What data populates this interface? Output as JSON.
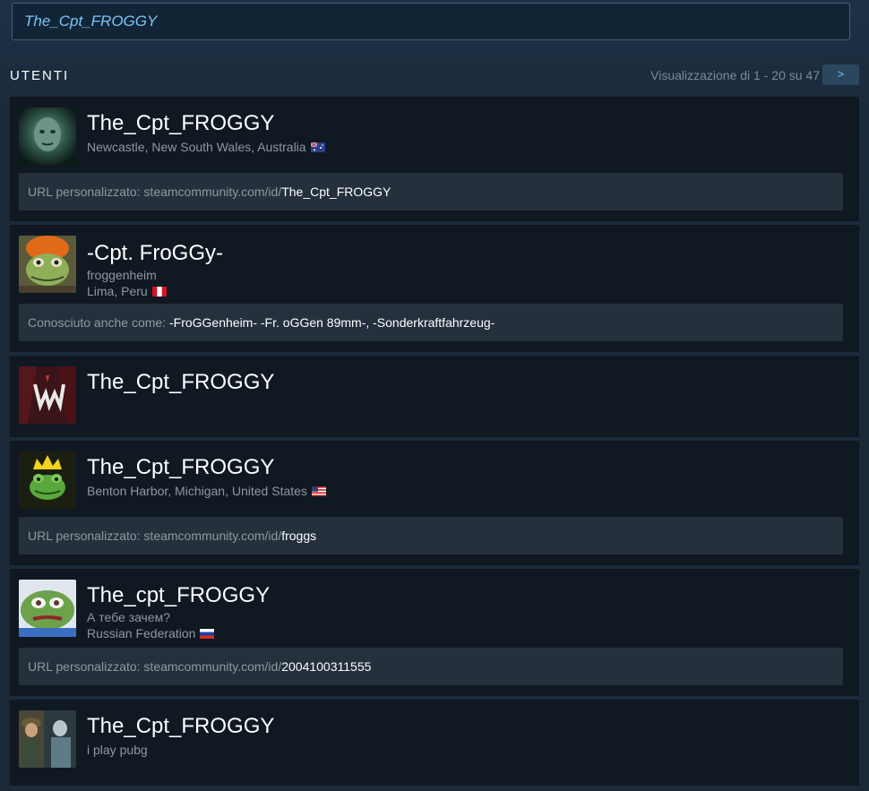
{
  "search": {
    "value": "The_Cpt_FROGGY"
  },
  "header": {
    "title": "UTENTI",
    "paging": "Visualizzazione di 1 - 20 su 47",
    "next_label": ">"
  },
  "results": [
    {
      "name": "The_Cpt_FROGGY",
      "location": "Newcastle, New South Wales, Australia",
      "flag": "flag-australia-icon",
      "info_label": "URL personalizzato: steamcommunity.com/id/",
      "info_value": "The_Cpt_FROGGY"
    },
    {
      "name": "-Cpt. FroGGy-",
      "real_name": "froggenheim",
      "location": "Lima, Peru",
      "flag": "flag-peru-icon",
      "info_label": "Conosciuto anche come: ",
      "info_value": "-FroGGenheim- -Fr. oGGen 89mm-, -Sonderkraftfahrzeug-"
    },
    {
      "name": "The_Cpt_FROGGY"
    },
    {
      "name": "The_Cpt_FROGGY",
      "location": "Benton Harbor, Michigan, United States",
      "flag": "flag-united-states-icon",
      "info_label": "URL personalizzato: steamcommunity.com/id/",
      "info_value": "froggs"
    },
    {
      "name": "The_cpt_FROGGY",
      "real_name": "А тебе зачем?",
      "location": "Russian Federation",
      "flag": "flag-russia-icon",
      "info_label": "URL personalizzato: steamcommunity.com/id/",
      "info_value": "2004100311555"
    },
    {
      "name": "The_Cpt_FROGGY",
      "real_name": "i play pubg"
    }
  ]
}
